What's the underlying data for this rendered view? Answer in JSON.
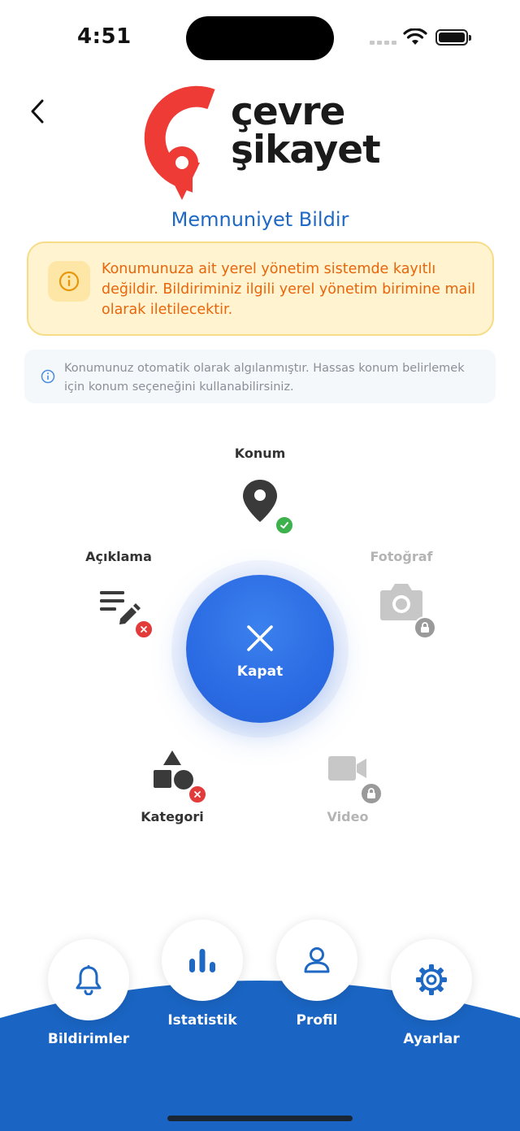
{
  "status_bar": {
    "time": "4:51"
  },
  "header": {
    "logo_line1": "çevre",
    "logo_line2": "şikayet",
    "title": "Memnuniyet Bildir",
    "brand_color": "#ee3b36"
  },
  "warning": {
    "text": "Konumunuza ait yerel yönetim sistemde kayıtlı değildir. Bildiriminiz ilgili yerel yönetim birimine mail olarak iletilecektir.",
    "color": "#e8650c"
  },
  "info": {
    "text": "Konumunuz otomatik olarak algılanmıştır. Hassas konum belirlemek için konum seçeneğini kullanabilirsiniz."
  },
  "options": {
    "location": {
      "label": "Konum",
      "status": "complete"
    },
    "description": {
      "label": "Açıklama",
      "status": "missing"
    },
    "photo": {
      "label": "Fotoğraf",
      "status": "locked"
    },
    "category": {
      "label": "Kategori",
      "status": "missing"
    },
    "video": {
      "label": "Video",
      "status": "locked"
    }
  },
  "close_button": {
    "label": "Kapat",
    "color": "#2b6be3"
  },
  "bottom_nav": {
    "notifications": "Bildirimler",
    "statistics": "Istatistik",
    "profile": "Profil",
    "settings": "Ayarlar",
    "background": "#1a65c3"
  }
}
